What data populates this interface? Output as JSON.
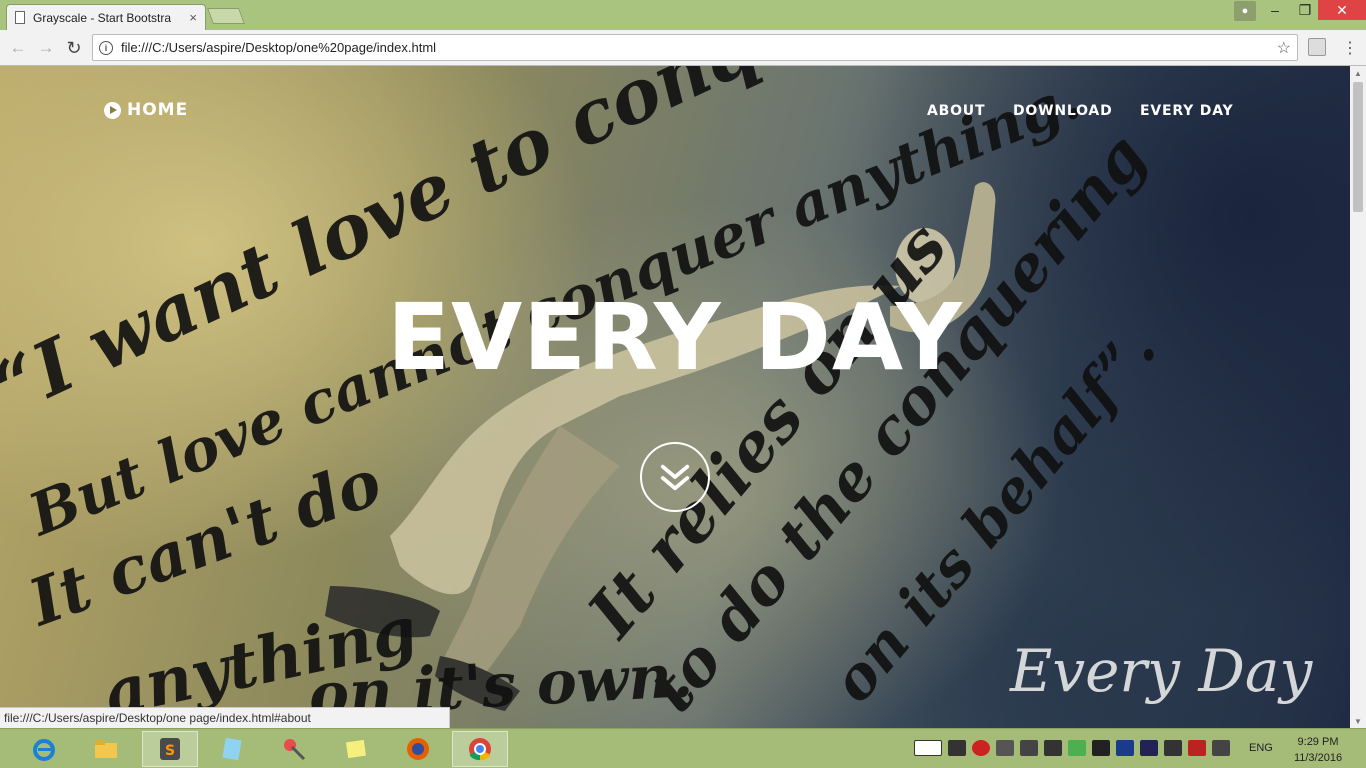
{
  "browser": {
    "tab_title": "Grayscale - Start Bootstra",
    "tab_close": "×",
    "url": "file:///C:/Users/aspire/Desktop/one%20page/index.html",
    "status_url": "file:///C:/Users/aspire/Desktop/one page/index.html#about",
    "icons": [
      "back-icon",
      "forward-icon",
      "reload-icon",
      "info-icon",
      "star-icon",
      "menu-icon"
    ]
  },
  "site": {
    "brand": "HOME",
    "nav": [
      "ABOUT",
      "DOWNLOAD",
      "EVERY DAY"
    ],
    "hero_title": "EVERY DAY",
    "quote_lines": [
      "“I want love to conquer a",
      "But love cannot conquer anything.",
      "It can't do",
      "anything",
      "on it's own.",
      "It relies on us",
      "to do the conquering",
      "on its behalf”."
    ],
    "signature": "Every Day"
  },
  "taskbar": {
    "apps": [
      "internet-explorer",
      "file-explorer",
      "sublime-text",
      "notepad",
      "snipping-tool",
      "sticky-notes",
      "firefox",
      "chrome"
    ],
    "language": "ENG",
    "time": "9:29 PM",
    "date": "11/3/2016"
  },
  "colors": {
    "title_bar": "#a9c47f",
    "close_button": "#e04343",
    "taskbar": "#a5bc78"
  }
}
